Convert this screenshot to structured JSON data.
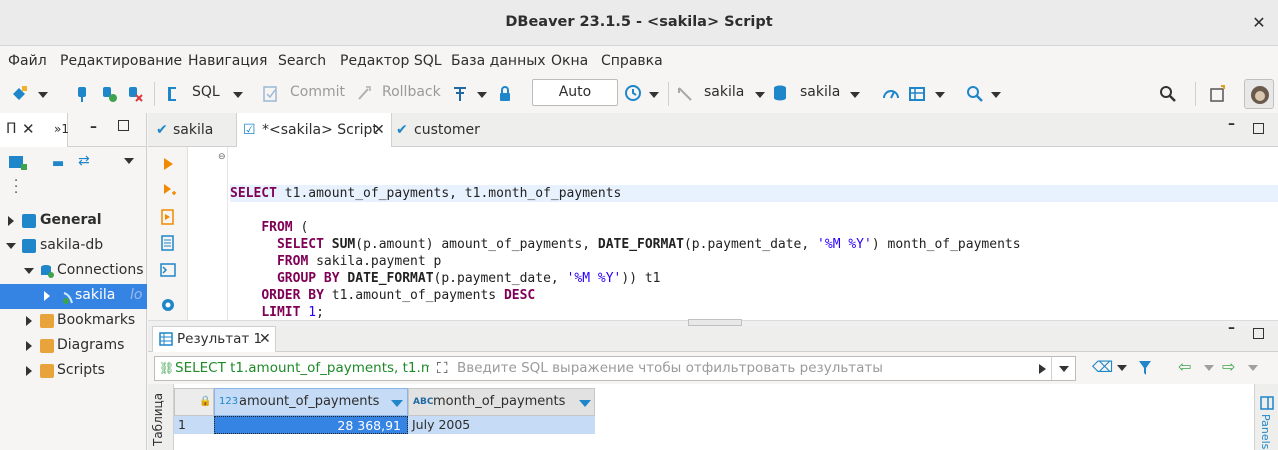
{
  "window": {
    "title": "DBeaver 23.1.5 - <sakila> Script",
    "close_glyph": "✕"
  },
  "menu": [
    "Файл",
    "Редактирование",
    "Навигация",
    "Search",
    "Редактор SQL",
    "База данных",
    "Окна",
    "Справка"
  ],
  "toolbar": {
    "sql_label": "SQL",
    "commit_label": "Commit",
    "rollback_label": "Rollback",
    "transaction_mode": "Auto",
    "datasource": "sakila",
    "schema": "sakila"
  },
  "left_panel": {
    "tab1_label": "П",
    "tab2_label": "»1",
    "tree": {
      "general": "General",
      "project": "sakila-db",
      "connections": "Connections",
      "connection_item": "sakila",
      "connection_suffix": "lo",
      "bookmarks": "Bookmarks",
      "diagrams": "Diagrams",
      "scripts": "Scripts"
    }
  },
  "editor_tabs": [
    {
      "label": "sakila",
      "active": false
    },
    {
      "label": "*<sakila> Script",
      "active": true
    },
    {
      "label": "customer",
      "active": false
    }
  ],
  "sql_lines": [
    "SELECT t1.amount_of_payments, t1.month_of_payments",
    "FROM (",
    "  SELECT SUM(p.amount) amount_of_payments, DATE_FORMAT(p.payment_date, '%M %Y') month_of_payments",
    "  FROM sakila.payment p",
    "  GROUP BY DATE_FORMAT(p.payment_date, '%M %Y')) t1",
    "ORDER BY t1.amount_of_payments DESC",
    "LIMIT 1;"
  ],
  "results": {
    "tab_label": "Результат 1",
    "query_preview": "SELECT t1.amount_of_payments, t1.m",
    "filter_placeholder": "Введите SQL выражение чтобы отфильтровать результаты",
    "side_tab": "Таблица",
    "right_tab": "Panels",
    "columns": [
      {
        "type_badge": "123",
        "name": "amount_of_payments"
      },
      {
        "type_badge": "ABC",
        "name": "month_of_payments"
      }
    ],
    "rows": [
      {
        "index": "1",
        "values": [
          "28 368,91",
          "July 2005"
        ]
      }
    ]
  },
  "colors": {
    "keyword": "#7f0055",
    "string": "#2a00ff",
    "selection": "#3584e4",
    "selected_cell": "#c6dbf5",
    "accent_blue": "#1f86c9"
  }
}
